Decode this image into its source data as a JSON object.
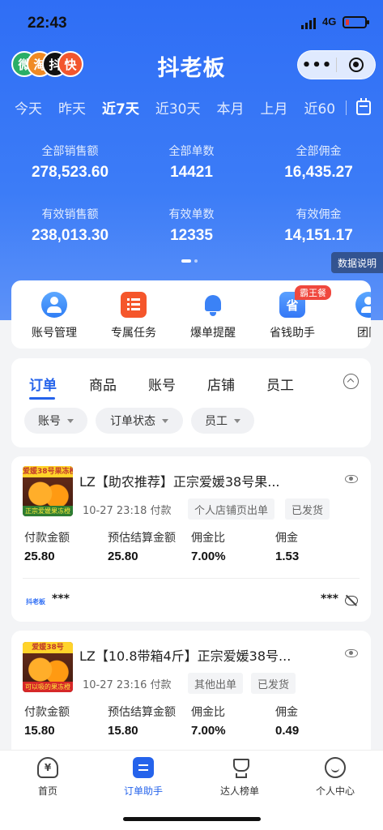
{
  "status_bar": {
    "time": "22:43",
    "network": "4G"
  },
  "header": {
    "title": "抖老板",
    "logos": [
      "微",
      "淘",
      "抖",
      "快"
    ],
    "logo_colors": [
      "#2aae67",
      "#f08a24",
      "#111111",
      "#f2562e"
    ],
    "capsule_more": "•••"
  },
  "date_tabs": [
    "今天",
    "昨天",
    "近7天",
    "近30天",
    "本月",
    "上月",
    "近60"
  ],
  "date_tab_active": "近7天",
  "stats": {
    "total_sales_label": "全部销售额",
    "total_sales": "278,523.60",
    "total_orders_label": "全部单数",
    "total_orders": "14421",
    "total_commission_label": "全部佣金",
    "total_commission": "16,435.27",
    "valid_sales_label": "有效销售额",
    "valid_sales": "238,013.30",
    "valid_orders_label": "有效单数",
    "valid_orders": "12335",
    "valid_commission_label": "有效佣金",
    "valid_commission": "14,151.17"
  },
  "data_explain": "数据说明",
  "shortcuts": {
    "account_mgmt": "账号管理",
    "exclusive_task": "专属任务",
    "hot_alert": "爆单提醒",
    "save_helper": "省钱助手",
    "save_icon_text": "省",
    "save_badge": "霸王餐",
    "team": "团队"
  },
  "order_tabs": {
    "orders": "订单",
    "products": "商品",
    "accounts": "账号",
    "shops": "店铺",
    "staff": "员工"
  },
  "filters": {
    "account": "账号",
    "order_status": "订单状态",
    "staff": "员工"
  },
  "orders": [
    {
      "title": "LZ【助农推荐】正宗爱媛38号果...",
      "thumb_tag": "爱媛38号果冻橙",
      "thumb_tag2": "正宗爱媛果冻橙",
      "time": "10-27 23:18 付款",
      "source": "个人店铺页出单",
      "status": "已发货",
      "pay_amount_label": "付款金额",
      "pay_amount": "25.80",
      "est_settle_label": "预估结算金额",
      "est_settle": "25.80",
      "commission_rate_label": "佣金比",
      "commission_rate": "7.00%",
      "commission_label": "佣金",
      "commission": "1.53",
      "shop_logo": "抖老板",
      "masked_left": "***",
      "masked_right": "***"
    },
    {
      "title": "LZ【10.8带箱4斤】正宗爱媛38号...",
      "thumb_tag": "爱媛38号",
      "thumb_tag2": "可以吸的果冻橙",
      "time": "10-27 23:16 付款",
      "source": "其他出单",
      "status": "已发货",
      "pay_amount_label": "付款金额",
      "pay_amount": "15.80",
      "est_settle_label": "预估结算金额",
      "est_settle": "15.80",
      "commission_rate_label": "佣金比",
      "commission_rate": "7.00%",
      "commission_label": "佣金",
      "commission": "0.49"
    }
  ],
  "bottom_nav": {
    "home": "首页",
    "home_icon_text": "¥",
    "order_helper": "订单助手",
    "ranking": "达人榜单",
    "profile": "个人中心"
  },
  "colors": {
    "accent": "#2563eb",
    "hero": "#3c7cf7",
    "task_orange": "#f5562b",
    "badge_red": "#f0483e"
  }
}
